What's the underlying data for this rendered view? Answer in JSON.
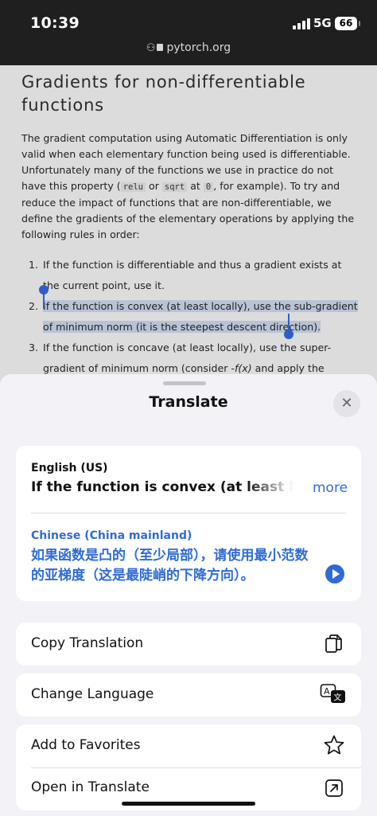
{
  "status_bar": {
    "time": "10:39",
    "network": "5G",
    "battery": "66"
  },
  "browser": {
    "url": "pytorch.org"
  },
  "article": {
    "title": "Gradients for non-differentiable functions",
    "para_part1": "The gradient computation using Automatic Differentiation is only valid when each elementary function being used is differentiable. Unfortunately many of the functions we use in practice do not have this property (",
    "code_relu": "relu",
    "para_or": " or ",
    "code_sqrt": "sqrt",
    "para_at": " at ",
    "code_zero": "0",
    "para_part2": ", for example). To try and reduce the impact of functions that are non-differentiable, we define the gradients of the elementary operations by applying the following rules in order:",
    "rules": [
      {
        "num": "1.",
        "text": "If the function is differentiable and thus a gradient exists at the current point, use it."
      },
      {
        "num": "2.",
        "text": "If the function is convex (at least locally), use the sub-gradient of minimum norm (it is the steepest descent direction)."
      },
      {
        "num": "3.",
        "text_a": "If the function is concave (at least locally), use the super-gradient of minimum norm (consider -",
        "text_b": "f(x)",
        "text_c": " and apply the previous point)."
      }
    ]
  },
  "translate_sheet": {
    "title": "Translate",
    "source_language": "English (US)",
    "source_text": "If the function is convex (at least locally), use the sub-gradient of minimum norm (it is the steepest descent direction).",
    "more_label": "more",
    "target_language": "Chinese (China mainland)",
    "target_text": "如果函数是凸的（至少局部），请使用最小范数的亚梯度（这是最陡峭的下降方向）。",
    "actions": [
      {
        "label": "Copy Translation",
        "icon": "copy-icon"
      },
      {
        "label": "Change Language",
        "icon": "translate-icon"
      },
      {
        "label": "Add to Favorites",
        "icon": "star-icon"
      },
      {
        "label": "Open in Translate",
        "icon": "open-external-icon"
      }
    ],
    "accent_color": "#2f6bd6"
  }
}
